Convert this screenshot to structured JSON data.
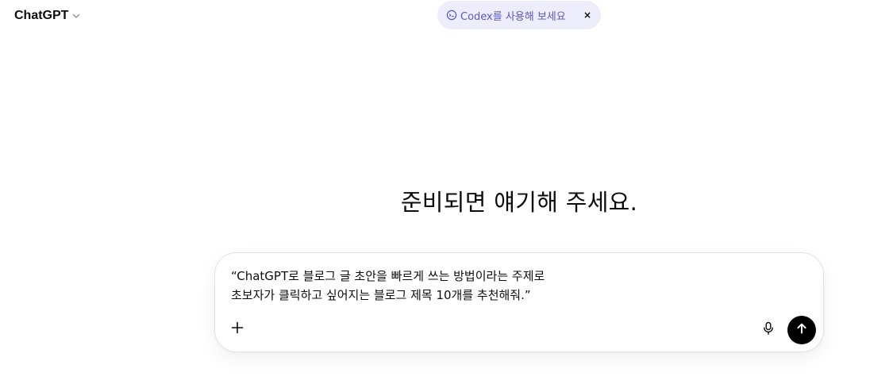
{
  "header": {
    "model_name": "ChatGPT",
    "model_dropdown_icon": "chevron-down-icon"
  },
  "banner": {
    "icon": "codex-icon",
    "text": "Codex를 사용해 보세요",
    "close_label": "×",
    "text_color": "#5a57c7",
    "background": "#eeedfb"
  },
  "main": {
    "headline": "준비되면 얘기해 주세요."
  },
  "composer": {
    "prompt_lines": [
      "“ChatGPT로 블로그 글 초안을 빠르게 쓰는 방법이라는 주제로",
      "초보자가 클릭하고 싶어지는 블로그 제목 10개를 추천해줘.”"
    ],
    "attach_icon": "plus-icon",
    "voice_icon": "microphone-icon",
    "send_icon": "arrow-up-icon",
    "send_button_color": "#000000"
  }
}
